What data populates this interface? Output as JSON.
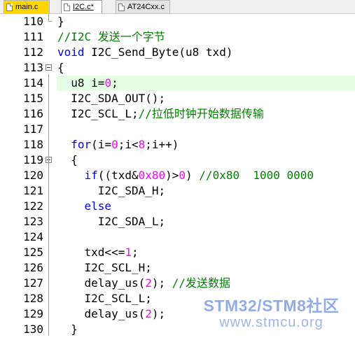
{
  "tabs": [
    {
      "label": "main.c",
      "active": false,
      "color": "#ffd700"
    },
    {
      "label": "I2C.c*",
      "active": true
    },
    {
      "label": "AT24Cxx.c",
      "active": false
    }
  ],
  "editor": {
    "lines": [
      {
        "num": "110",
        "tokens": [
          {
            "t": "}",
            "c": ""
          }
        ]
      },
      {
        "num": "111",
        "tokens": [
          {
            "t": "//I2C 发送一个字节",
            "c": "c"
          }
        ]
      },
      {
        "num": "112",
        "tokens": [
          {
            "t": "void",
            "c": "k"
          },
          {
            "t": " I2C_Send_Byte(u8 txd)",
            "c": ""
          }
        ]
      },
      {
        "num": "113",
        "tokens": [
          {
            "t": "{",
            "c": ""
          }
        ]
      },
      {
        "num": "114",
        "tokens": [
          {
            "t": "  u8 i=",
            "c": ""
          },
          {
            "t": "0",
            "c": "n"
          },
          {
            "t": ";",
            "c": ""
          }
        ]
      },
      {
        "num": "115",
        "tokens": [
          {
            "t": "  I2C_SDA_OUT();",
            "c": ""
          }
        ]
      },
      {
        "num": "116",
        "tokens": [
          {
            "t": "  I2C_SCL_L;",
            "c": ""
          },
          {
            "t": "//拉低时钟开始数据传输",
            "c": "c"
          }
        ]
      },
      {
        "num": "117",
        "tokens": []
      },
      {
        "num": "118",
        "tokens": [
          {
            "t": "  ",
            "c": ""
          },
          {
            "t": "for",
            "c": "k"
          },
          {
            "t": "(i=",
            "c": ""
          },
          {
            "t": "0",
            "c": "n"
          },
          {
            "t": ";i<",
            "c": ""
          },
          {
            "t": "8",
            "c": "n"
          },
          {
            "t": ";i++)",
            "c": ""
          }
        ]
      },
      {
        "num": "119",
        "tokens": [
          {
            "t": "  {",
            "c": ""
          }
        ]
      },
      {
        "num": "120",
        "tokens": [
          {
            "t": "    ",
            "c": ""
          },
          {
            "t": "if",
            "c": "k"
          },
          {
            "t": "((txd&",
            "c": ""
          },
          {
            "t": "0x80",
            "c": "n"
          },
          {
            "t": ")>",
            "c": ""
          },
          {
            "t": "0",
            "c": "n"
          },
          {
            "t": ") ",
            "c": ""
          },
          {
            "t": "//0x80  1000 0000",
            "c": "c"
          }
        ]
      },
      {
        "num": "121",
        "tokens": [
          {
            "t": "      I2C_SDA_H;",
            "c": ""
          }
        ]
      },
      {
        "num": "122",
        "tokens": [
          {
            "t": "    ",
            "c": ""
          },
          {
            "t": "else",
            "c": "k"
          }
        ]
      },
      {
        "num": "123",
        "tokens": [
          {
            "t": "      I2C_SDA_L;",
            "c": ""
          }
        ]
      },
      {
        "num": "124",
        "tokens": []
      },
      {
        "num": "125",
        "tokens": [
          {
            "t": "    txd<<=",
            "c": ""
          },
          {
            "t": "1",
            "c": "n"
          },
          {
            "t": ";",
            "c": ""
          }
        ]
      },
      {
        "num": "126",
        "tokens": [
          {
            "t": "    I2C_SCL_H;",
            "c": ""
          }
        ]
      },
      {
        "num": "127",
        "tokens": [
          {
            "t": "    delay_us(",
            "c": ""
          },
          {
            "t": "2",
            "c": "n"
          },
          {
            "t": "); ",
            "c": ""
          },
          {
            "t": "//发送数据",
            "c": "c"
          }
        ]
      },
      {
        "num": "128",
        "tokens": [
          {
            "t": "    I2C_SCL_L;",
            "c": ""
          }
        ]
      },
      {
        "num": "129",
        "tokens": [
          {
            "t": "    delay_us(",
            "c": ""
          },
          {
            "t": "2",
            "c": "n"
          },
          {
            "t": ");",
            "c": ""
          }
        ]
      },
      {
        "num": "130",
        "tokens": [
          {
            "t": "  }",
            "c": ""
          }
        ]
      }
    ],
    "highlight_line": "114",
    "colors": {
      "keyword": "#0000ff",
      "number": "#ff00ff",
      "comment": "#008000",
      "highlight": "#e5ffe5"
    }
  },
  "watermark": {
    "line1": "STM32/STM8社区",
    "line2": "www.stmcu.org"
  }
}
